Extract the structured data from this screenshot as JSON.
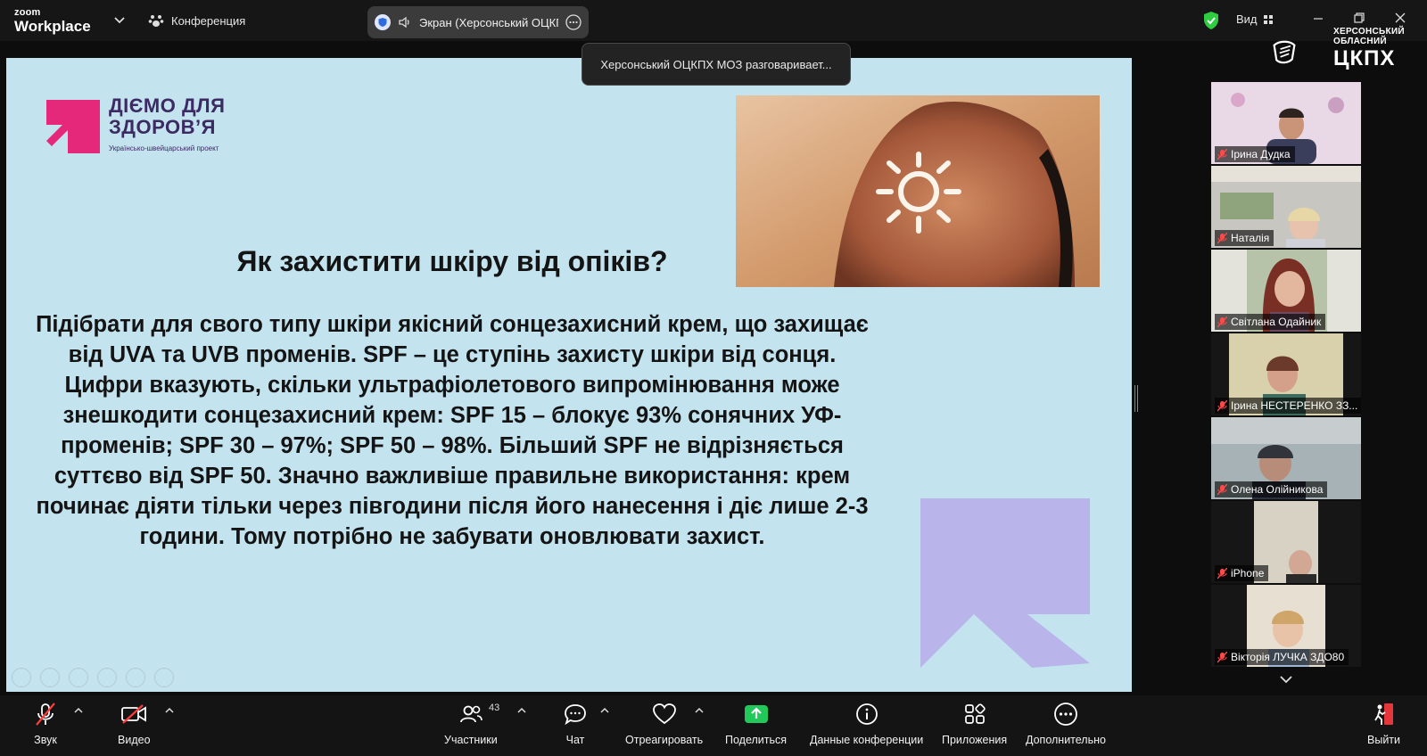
{
  "app": {
    "logo_small": "zoom",
    "logo_big": "Workplace"
  },
  "topbar": {
    "conference_label": "Конференция",
    "screen_share_title": "Экран (Херсонський ОЦКП",
    "view_label": "Вид",
    "speaking_notice": "Херсонський ОЦКПХ МОЗ разговаривает..."
  },
  "brand": {
    "line1": "ХЕРСОНСЬКИЙ",
    "line2": "ОБЛАСНИЙ",
    "line3": "ЦКПХ"
  },
  "slide": {
    "brand_name_1": "ДІЄМО ДЛЯ",
    "brand_name_2": "ЗДОРОВ’Я",
    "brand_sub": "Українсько-швейцарський проект",
    "title": "Як захистити шкіру від опіків?",
    "body": "Підібрати для свого типу шкіри якісний сонцезахисний крем, що захищає від UVA та UVB променів. SPF – це ступінь захисту шкіри від сонця. Цифри вказують, скільки ультрафіолетового випромінювання може знешкодити сонцезахисний крем: SPF 15 – блокує 93% сонячних УФ-променів; SPF 30 – 97%; SPF 50 – 98%. Більший SPF не відрізняється суттєво від SPF 50. Значно важливіше правильне використання: крем починає діяти тільки через півгодини після його нанесення і діє лише 2-3 години. Тому потрібно не забувати оновлювати захист.",
    "colors": {
      "background": "#c3e3ef",
      "brand_pink": "#e6287a",
      "brand_purple": "#3c2a63",
      "arrow": "#b9b5ea"
    }
  },
  "participants": [
    {
      "name": "Ірина Дудка",
      "muted": true
    },
    {
      "name": "Наталія",
      "muted": true
    },
    {
      "name": "Світлана Одайник",
      "muted": true
    },
    {
      "name": "Ірина НЕСТЕРЕНКО ЗЗ...",
      "muted": true
    },
    {
      "name": "Олена Олійникова",
      "muted": true
    },
    {
      "name": "iPhone",
      "muted": true
    },
    {
      "name": "Вікторія ЛУЧКА ЗДО80",
      "muted": true
    }
  ],
  "toolbar": {
    "audio": "Звук",
    "video": "Видео",
    "participants": "Участники",
    "participants_count": "43",
    "chat": "Чат",
    "react": "Отреагировать",
    "share": "Поделиться",
    "info": "Данные конференции",
    "apps": "Приложения",
    "more": "Дополнительно",
    "leave": "Выйти",
    "share_color": "#21c95b",
    "leave_color": "#e5363b"
  }
}
